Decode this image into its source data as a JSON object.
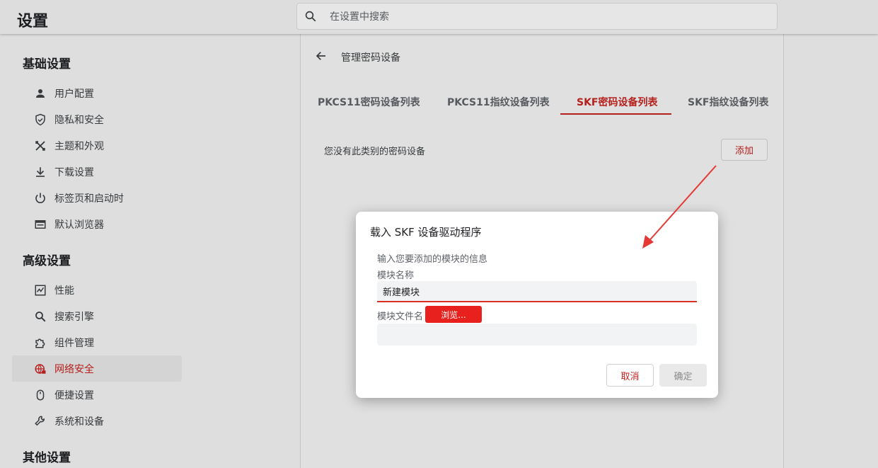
{
  "header": {
    "title": "设置",
    "search_placeholder": "在设置中搜索",
    "search_icon": "search-icon"
  },
  "sidebar": {
    "sections": [
      {
        "title": "基础设置",
        "items": [
          {
            "label": "用户配置",
            "icon": "person-icon"
          },
          {
            "label": "隐私和安全",
            "icon": "shield-icon"
          },
          {
            "label": "主题和外观",
            "icon": "palette-icon"
          },
          {
            "label": "下载设置",
            "icon": "download-icon"
          },
          {
            "label": "标签页和启动时",
            "icon": "power-icon"
          },
          {
            "label": "默认浏览器",
            "icon": "browser-icon"
          }
        ]
      },
      {
        "title": "高级设置",
        "items": [
          {
            "label": "性能",
            "icon": "performance-icon"
          },
          {
            "label": "搜索引擎",
            "icon": "search-icon"
          },
          {
            "label": "组件管理",
            "icon": "puzzle-icon"
          },
          {
            "label": "网络安全",
            "icon": "globe-lock-icon",
            "active": true
          },
          {
            "label": "便捷设置",
            "icon": "mouse-icon"
          },
          {
            "label": "系统和设备",
            "icon": "wrench-icon"
          }
        ]
      },
      {
        "title": "其他设置",
        "items": []
      }
    ]
  },
  "main": {
    "breadcrumb": "管理密码设备",
    "tabs": [
      {
        "label": "PKCS11密码设备列表"
      },
      {
        "label": "PKCS11指纹设备列表"
      },
      {
        "label": "SKF密码设备列表",
        "active": true
      },
      {
        "label": "SKF指纹设备列表"
      }
    ],
    "empty_message": "您没有此类别的密码设备",
    "add_label": "添加"
  },
  "dialog": {
    "title": "载入 SKF 设备驱动程序",
    "info": "输入您要添加的模块的信息",
    "module_name_label": "模块名称",
    "module_name_value": "新建模块",
    "module_file_label": "模块文件名",
    "browse_label": "浏览...",
    "cancel_label": "取消",
    "ok_label": "确定"
  },
  "colors": {
    "accent": "#c5221f",
    "browse_button": "#e8201e",
    "annotation_arrow": "#e53935"
  }
}
